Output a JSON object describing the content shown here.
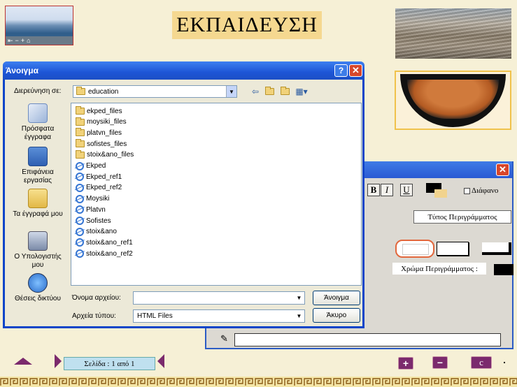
{
  "app": {
    "title": "ΕΚΠΑΙΔΕΥΣΗ"
  },
  "thumbnail": {
    "controls": [
      "⇤",
      "−",
      "+",
      "⌂"
    ]
  },
  "open_dialog": {
    "title": "Άνοιγμα",
    "help": "?",
    "close": "✕",
    "look_in_label": "Διερεύνηση σε:",
    "look_in_value": "education",
    "places": [
      {
        "label": "Πρόσφατα έγγραφα",
        "icon": "recent-documents-icon"
      },
      {
        "label": "Επιφάνεια εργασίας",
        "icon": "desktop-icon"
      },
      {
        "label": "Τα έγγραφά μου",
        "icon": "my-documents-icon"
      },
      {
        "label": "Ο Υπολογιστής μου",
        "icon": "my-computer-icon"
      },
      {
        "label": "Θέσεις δικτύου",
        "icon": "network-places-icon"
      }
    ],
    "files": [
      {
        "name": "ekped_files",
        "type": "folder"
      },
      {
        "name": "moysiki_files",
        "type": "folder"
      },
      {
        "name": "platvn_files",
        "type": "folder"
      },
      {
        "name": "sofistes_files",
        "type": "folder"
      },
      {
        "name": "stoix&ano_files",
        "type": "folder"
      },
      {
        "name": "Ekped",
        "type": "html"
      },
      {
        "name": "Ekped_ref1",
        "type": "html"
      },
      {
        "name": "Ekped_ref2",
        "type": "html"
      },
      {
        "name": "Moysiki",
        "type": "html"
      },
      {
        "name": "Platvn",
        "type": "html"
      },
      {
        "name": "Sofistes",
        "type": "html"
      },
      {
        "name": "stoix&ano",
        "type": "html"
      },
      {
        "name": "stoix&ano_ref1",
        "type": "html"
      },
      {
        "name": "stoix&ano_ref2",
        "type": "html"
      }
    ],
    "file_name_label": "Όνομα αρχείου:",
    "file_name_value": "",
    "file_type_label": "Αρχεία τύπου:",
    "file_type_value": "HTML Files",
    "open_button": "Άνοιγμα",
    "cancel_button": "Άκυρο"
  },
  "format_dialog": {
    "close": "✕",
    "bold": "B",
    "italic": "I",
    "underline": "U",
    "transparent_label": "Διάφανο",
    "border_type_label": "Τύπος Περιγράμματος",
    "border_color_label": "Χρώμα Περιγράμματος :",
    "input_value": ""
  },
  "footer": {
    "page_indicator": "Σελίδα : 1 από 1",
    "plus": "+",
    "minus": "−",
    "c": "c"
  },
  "colors": {
    "accent": "#7b2a6d",
    "titlebar": "#1d55d6",
    "background": "#f6f0d6"
  }
}
